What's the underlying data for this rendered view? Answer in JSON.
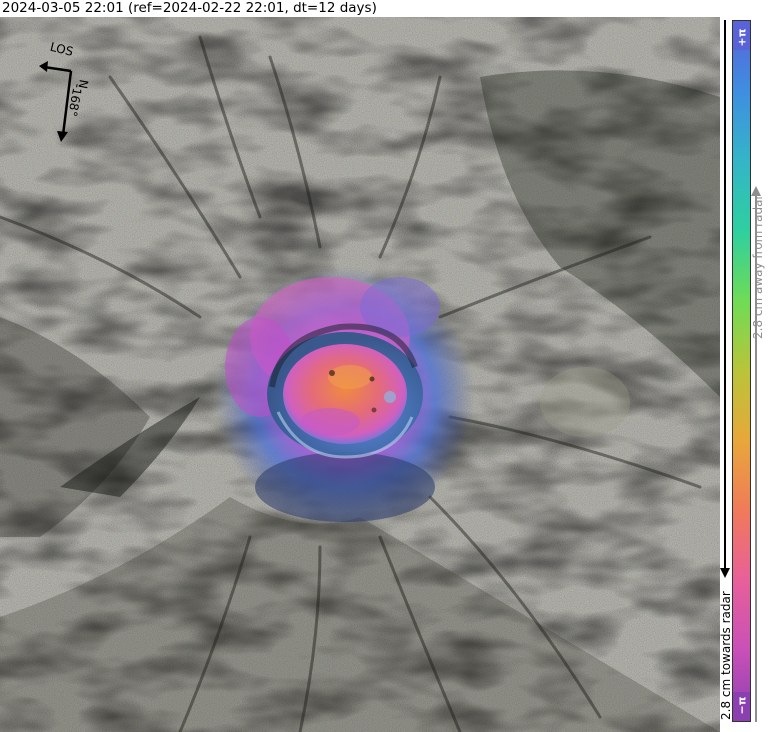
{
  "title": "2024-03-05 22:01 (ref=2024-02-22 22:01, dt=12 days)",
  "colorbar": {
    "top_label": "+π",
    "bottom_label": "−π",
    "away_text": "2.8 cm away from radar",
    "towards_text": "2.8 cm towards radar",
    "colors": [
      "#8b3fb0",
      "#c850b8",
      "#e7609a",
      "#f07a5a",
      "#e8a73a",
      "#b9c43a",
      "#6fdc55",
      "#2fcfa0",
      "#34b5c8",
      "#3f8ee0",
      "#5a62d8"
    ],
    "away_color": "#8e8e8e",
    "towards_color": "#000000"
  },
  "compass": {
    "los_label": "LOS",
    "north_label": "N",
    "heading_label": "-168°"
  },
  "image": {
    "crater_colors": [
      "#e070c0",
      "#f08a40",
      "#d060c0",
      "#7080e0",
      "#38b0d0"
    ],
    "terrain_base": "#7a7a6a"
  }
}
